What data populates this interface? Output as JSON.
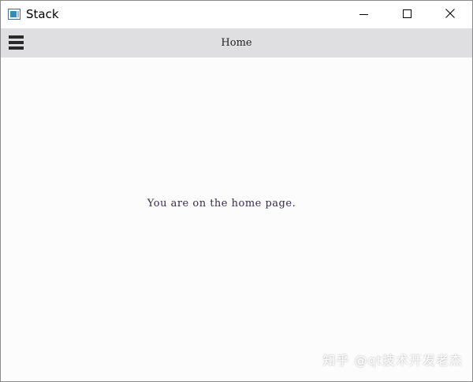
{
  "window": {
    "title": "Stack",
    "minimize_symbol": "",
    "maximize_symbol": "",
    "close_symbol": ""
  },
  "toolbar": {
    "menu_icon": "hamburger-menu-icon",
    "title": "Home"
  },
  "page": {
    "message": "You are on the home page."
  },
  "watermark": {
    "text": "知乎 @qt技术开发老杰"
  },
  "colors": {
    "toolbar_bg": "#dfdfe2",
    "content_bg": "#fcfcfd",
    "message_text": "#3a2a4a"
  }
}
